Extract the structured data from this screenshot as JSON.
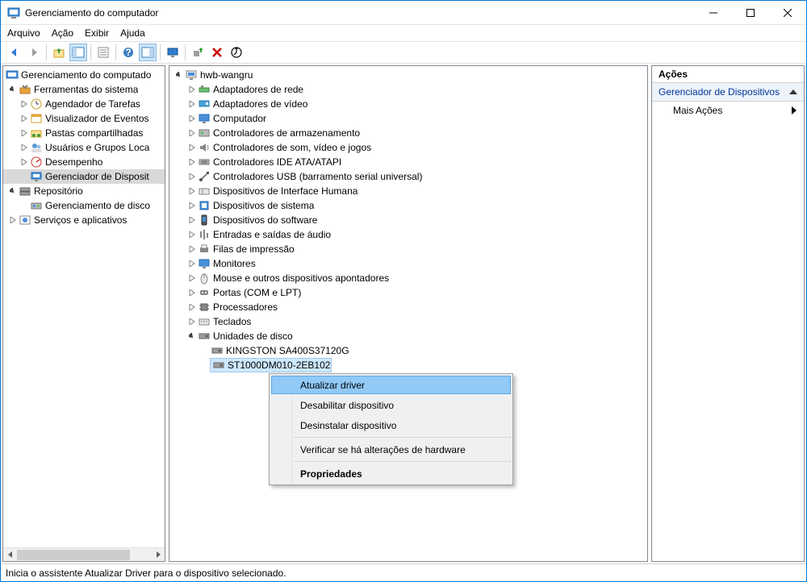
{
  "title": "Gerenciamento do computador",
  "menu": {
    "file": "Arquivo",
    "action": "Ação",
    "view": "Exibir",
    "help": "Ajuda"
  },
  "left_tree": {
    "root": "Gerenciamento do computado",
    "sys_tools": "Ferramentas do sistema",
    "task_scheduler": "Agendador de Tarefas",
    "event_viewer": "Visualizador de Eventos",
    "shared_folders": "Pastas compartilhadas",
    "local_users": "Usuários e Grupos Loca",
    "performance": "Desempenho",
    "device_manager": "Gerenciador de Disposit",
    "storage": "Repositório",
    "disk_mgmt": "Gerenciamento de disco",
    "services_apps": "Serviços e aplicativos"
  },
  "center": {
    "host": "hwb-wangru",
    "cats": {
      "net": "Adaptadores de rede",
      "video": "Adaptadores de vídeo",
      "computer": "Computador",
      "storage_ctl": "Controladores de armazenamento",
      "sound_ctl": "Controladores de som, vídeo e jogos",
      "ide": "Controladores IDE ATA/ATAPI",
      "usb": "Controladores USB (barramento serial universal)",
      "hid": "Dispositivos de Interface Humana",
      "sysdev": "Dispositivos de sistema",
      "softdev": "Dispositivos do software",
      "audio_io": "Entradas e saídas de áudio",
      "print_q": "Filas de impressão",
      "monitors": "Monitores",
      "mouse": "Mouse e outros dispositivos apontadores",
      "ports": "Portas (COM e LPT)",
      "cpu": "Processadores",
      "kbd": "Teclados",
      "disks": "Unidades de disco"
    },
    "disk_children": {
      "kingston": "KINGSTON SA400S37120G",
      "st1000": "ST1000DM010-2EB102"
    }
  },
  "actions": {
    "title": "Ações",
    "section": "Gerenciador de Dispositivos",
    "more": "Mais Ações"
  },
  "context_menu": {
    "update": "Atualizar driver",
    "disable": "Desabilitar dispositivo",
    "uninstall": "Desinstalar dispositivo",
    "scan": "Verificar se há alterações de hardware",
    "properties": "Propriedades"
  },
  "status": "Inicia o assistente Atualizar Driver para o dispositivo selecionado."
}
